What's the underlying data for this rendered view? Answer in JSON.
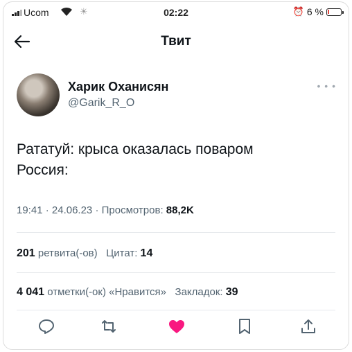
{
  "status_bar": {
    "carrier": "Ucom",
    "time": "02:22",
    "battery_text": "6 %",
    "battery_level": 0.06
  },
  "header": {
    "title": "Твит"
  },
  "author": {
    "name": "Харик Оханисян",
    "handle": "@Garik_R_O"
  },
  "tweet": {
    "lines": [
      "Рататуй: крыса оказалась поваром",
      "Россия:"
    ],
    "time": "19:41",
    "date": "24.06.23",
    "views_label": "Просмотров:",
    "views_value": "88,2K"
  },
  "stats": {
    "retweets_value": "201",
    "retweets_label": "ретвита(-ов)",
    "quotes_label": "Цитат:",
    "quotes_value": "14",
    "likes_value": "4 041",
    "likes_label": "отметки(-ок) «Нравится»",
    "bookmarks_label": "Закладок:",
    "bookmarks_value": "39"
  },
  "icons": {
    "back": "arrow-left-icon",
    "more": "more-dots-icon",
    "reply": "reply-icon",
    "retweet": "retweet-icon",
    "like": "heart-icon",
    "bookmark": "bookmark-icon",
    "share": "share-icon"
  },
  "colors": {
    "like_active": "#f91880",
    "secondary_text": "#536471",
    "battery_low": "#e0443c"
  }
}
